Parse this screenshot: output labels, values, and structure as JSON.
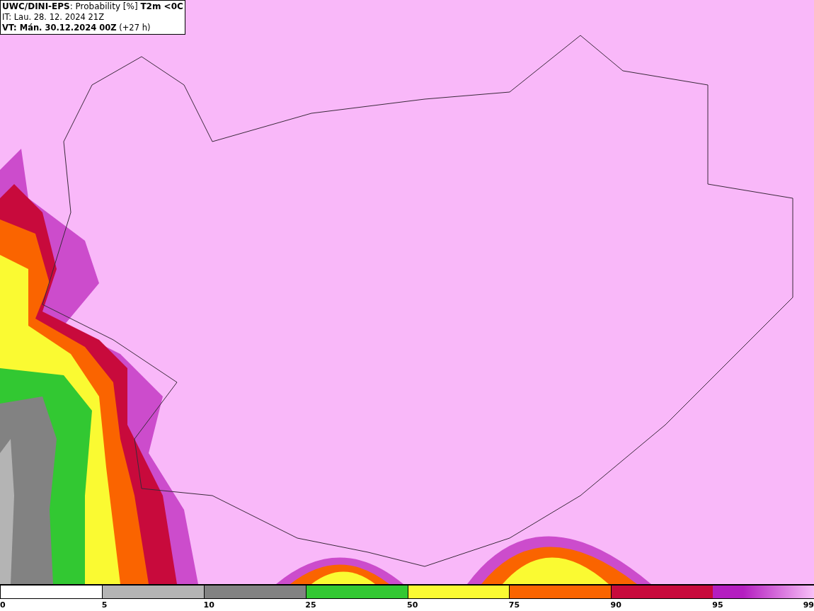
{
  "header": {
    "title": "**UWC/DINI-EPS**: Probability [%] **T2m <0C**",
    "issue_time": "IT: Lau. 28. 12. 2024 21Z",
    "valid_time": "**VT: Mán. 30.12.2024 00Z** (+27 h)"
  },
  "legend": {
    "segments": [
      {
        "from": "0",
        "color": "#ffffff",
        "kind": "solid"
      },
      {
        "from": "5",
        "color": "#b4b4b4",
        "kind": "solid"
      },
      {
        "from": "10",
        "color": "#828282",
        "kind": "solid"
      },
      {
        "from": "25",
        "color": "#32c832",
        "kind": "solid"
      },
      {
        "from": "50",
        "color": "#fafa32",
        "kind": "solid"
      },
      {
        "from": "75",
        "color": "#fa6400",
        "kind": "solid"
      },
      {
        "from": "90",
        "color": "#c80a3c",
        "kind": "solid"
      },
      {
        "from": "95",
        "color": "#b41ec0",
        "kind": "gradient"
      }
    ],
    "end_label": "99"
  }
}
